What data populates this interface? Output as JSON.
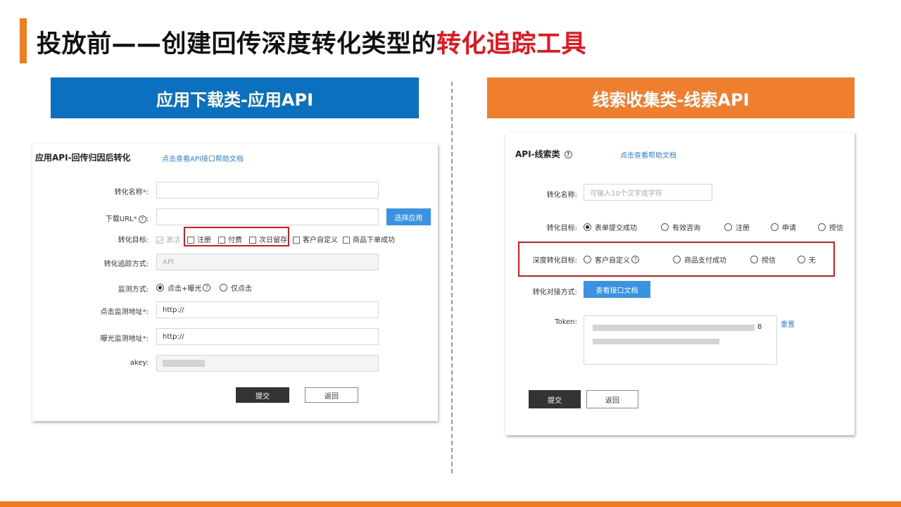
{
  "page": {
    "title_prefix": "投放前——创建回传深度转化类型的",
    "title_highlight": "转化追踪工具",
    "accent_color": "#f07d1f",
    "highlight_color": "#e8141b"
  },
  "left": {
    "banner": "应用下载类-应用API",
    "banner_color": "#0b70bf",
    "panel_title": "应用API-回传归因后转化",
    "help_link": "点击查看API接口帮助文档",
    "fields": {
      "name_label": "转化名称",
      "url_label": "下载URL",
      "select_app_button": "选择应用",
      "target_label": "转化目标:",
      "targets": [
        "激活",
        "注册",
        "付费",
        "次日留存",
        "客户自定义",
        "商品下单成功"
      ],
      "method_label": "转化追踪方式:",
      "method_value": "API",
      "monitor_label": "监测方式:",
      "monitor_options": [
        "点击+曝光",
        "仅点击"
      ],
      "click_url_label": "点击监测地址",
      "click_url_value": "http://",
      "impression_url_label": "曝光监测地址",
      "impression_url_value": "http://",
      "akey_label": "akey:"
    },
    "submit": "提交",
    "back": "返回",
    "required_mark": "*",
    "colon": ":"
  },
  "right": {
    "banner": "线索收集类-线索API",
    "banner_color": "#ef7f2e",
    "panel_title": "API-线索类",
    "help_link": "点击查看帮助文档",
    "fields": {
      "name_label": "转化名称:",
      "name_placeholder": "可输入10个汉字或字符",
      "target_label": "转化目标:",
      "targets": [
        "表单提交成功",
        "有效咨询",
        "注册",
        "申请",
        "授信"
      ],
      "deep_target_label": "深度转化目标:",
      "deep_targets": [
        "客户自定义",
        "商品支付成功",
        "授信",
        "无"
      ],
      "connect_label": "转化对接方式:",
      "doc_button": "查看接口文档",
      "token_label": "Token:",
      "reset_link": "重置",
      "token_suffix": "8"
    },
    "submit": "提交",
    "back": "返回"
  },
  "icons": {
    "help": "question-circle-icon",
    "checkbox": "checkbox-icon",
    "radio": "radio-icon"
  }
}
